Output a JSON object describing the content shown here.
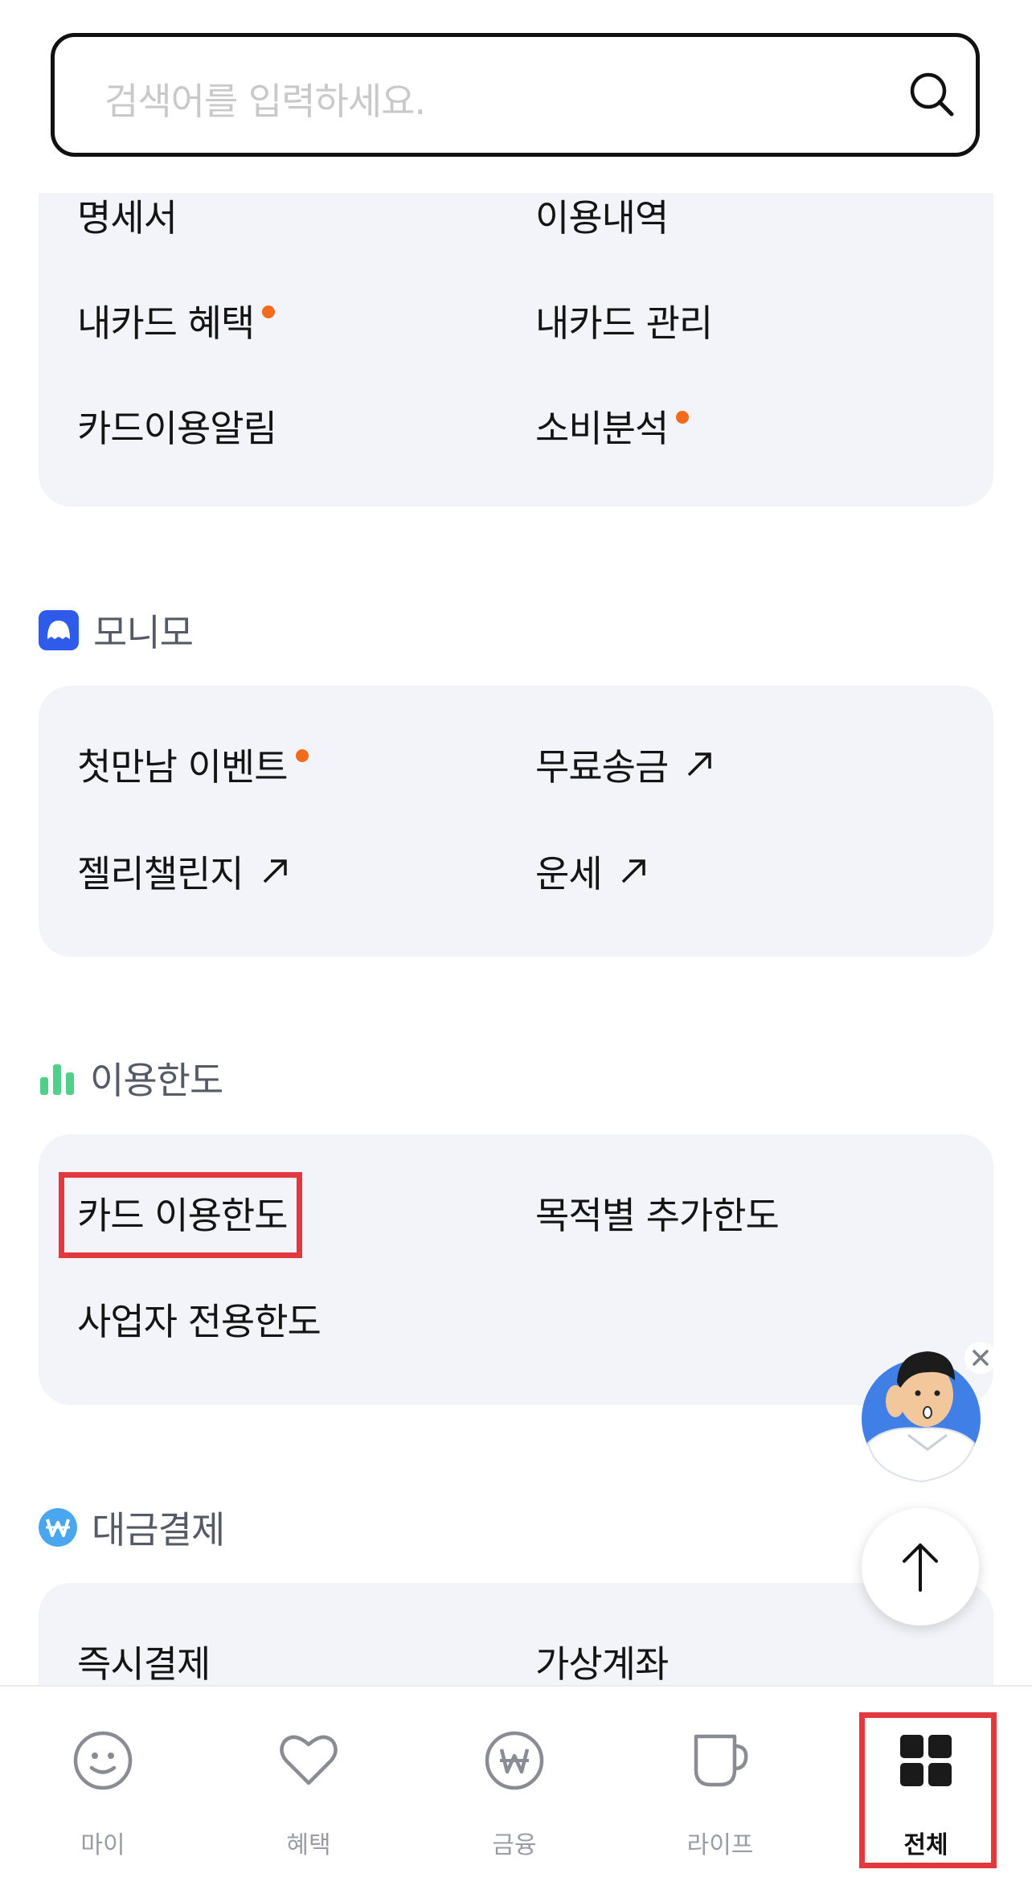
{
  "search": {
    "placeholder": "검색어를 입력하세요."
  },
  "card_section": {
    "items": [
      {
        "label": "명세서"
      },
      {
        "label": "이용내역"
      },
      {
        "label": "내카드 혜택",
        "new": true
      },
      {
        "label": "내카드 관리"
      },
      {
        "label": "카드이용알림"
      },
      {
        "label": "소비분석",
        "new": true
      }
    ]
  },
  "monimo": {
    "title": "모니모",
    "items": [
      {
        "label": "첫만남 이벤트",
        "new": true
      },
      {
        "label": "무료송금",
        "external": true
      },
      {
        "label": "젤리챌린지",
        "external": true
      },
      {
        "label": "운세",
        "external": true
      }
    ]
  },
  "limit": {
    "title": "이용한도",
    "items": [
      {
        "label": "카드 이용한도",
        "highlighted": true
      },
      {
        "label": "목적별 추가한도"
      },
      {
        "label": "사업자 전용한도"
      }
    ]
  },
  "payment": {
    "title": "대금결제",
    "items": [
      {
        "label": "즉시결제"
      },
      {
        "label": "가상계좌"
      }
    ]
  },
  "tabs": [
    {
      "label": "마이",
      "icon": "smile-icon"
    },
    {
      "label": "혜택",
      "icon": "heart-icon"
    },
    {
      "label": "금융",
      "icon": "won-icon"
    },
    {
      "label": "라이프",
      "icon": "cup-icon"
    },
    {
      "label": "전체",
      "icon": "grid-icon",
      "active": true
    }
  ],
  "colors": {
    "accent_dot": "#f26a1b",
    "card_bg": "#f3f4f9",
    "highlight": "#e2393f",
    "monimo_icon": "#2f5bea",
    "limit_icon": "#4fcf8a",
    "payment_icon": "#4aa6ee"
  }
}
